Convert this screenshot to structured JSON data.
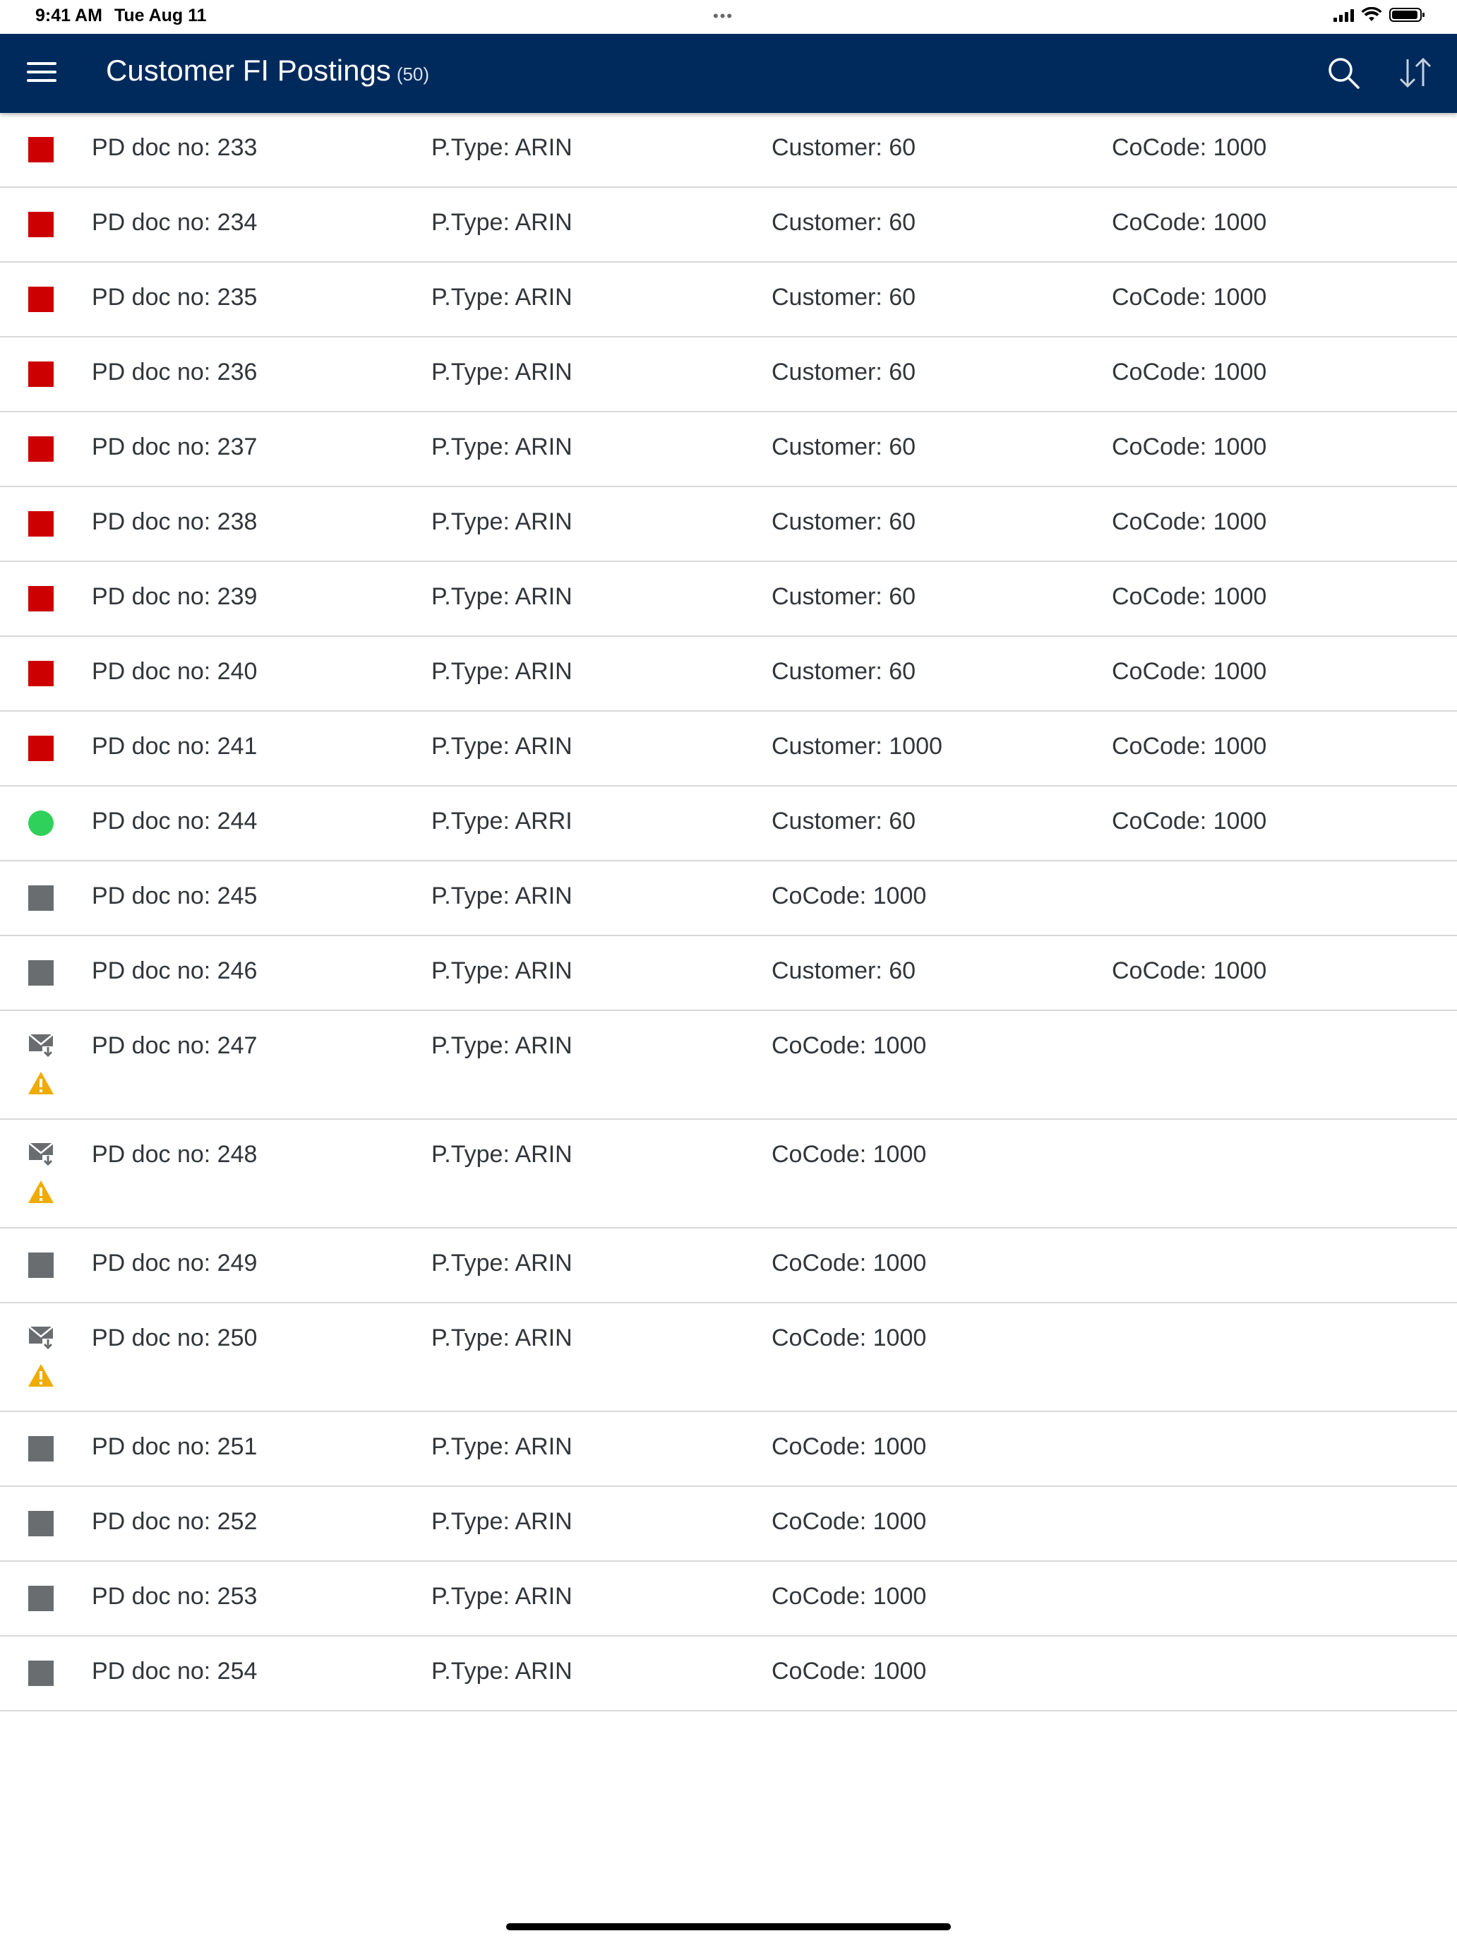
{
  "status_bar": {
    "time": "9:41 AM",
    "date": "Tue Aug 11",
    "dots": "•••"
  },
  "header": {
    "title": "Customer FI Postings",
    "count": "(50)"
  },
  "colors": {
    "nav_bg": "#002a5c",
    "error": "#cc0000",
    "success": "#2fd15a",
    "neutral": "#6a6d70",
    "warning": "#f0ab00"
  },
  "icons": {
    "menu": "menu-icon",
    "search": "search-icon",
    "sort": "sort-icon"
  },
  "rows": [
    {
      "status": "error",
      "doc": "PD doc no: 233",
      "ptype": "P.Type: ARIN",
      "col3": "Customer: 60",
      "col4": "CoCode: 1000"
    },
    {
      "status": "error",
      "doc": "PD doc no: 234",
      "ptype": "P.Type: ARIN",
      "col3": "Customer: 60",
      "col4": "CoCode: 1000"
    },
    {
      "status": "error",
      "doc": "PD doc no: 235",
      "ptype": "P.Type: ARIN",
      "col3": "Customer: 60",
      "col4": "CoCode: 1000"
    },
    {
      "status": "error",
      "doc": "PD doc no: 236",
      "ptype": "P.Type: ARIN",
      "col3": "Customer: 60",
      "col4": "CoCode: 1000"
    },
    {
      "status": "error",
      "doc": "PD doc no: 237",
      "ptype": "P.Type: ARIN",
      "col3": "Customer: 60",
      "col4": "CoCode: 1000"
    },
    {
      "status": "error",
      "doc": "PD doc no: 238",
      "ptype": "P.Type: ARIN",
      "col3": "Customer: 60",
      "col4": "CoCode: 1000"
    },
    {
      "status": "error",
      "doc": "PD doc no: 239",
      "ptype": "P.Type: ARIN",
      "col3": "Customer: 60",
      "col4": "CoCode: 1000"
    },
    {
      "status": "error",
      "doc": "PD doc no: 240",
      "ptype": "P.Type: ARIN",
      "col3": "Customer: 60",
      "col4": "CoCode: 1000"
    },
    {
      "status": "error",
      "doc": "PD doc no: 241",
      "ptype": "P.Type: ARIN",
      "col3": "Customer: 1000",
      "col4": "CoCode: 1000"
    },
    {
      "status": "success",
      "doc": "PD doc no: 244",
      "ptype": "P.Type: ARRI",
      "col3": "Customer: 60",
      "col4": "CoCode: 1000"
    },
    {
      "status": "neutral",
      "doc": "PD doc no: 245",
      "ptype": "P.Type: ARIN",
      "col3": "CoCode: 1000",
      "col4": ""
    },
    {
      "status": "neutral",
      "doc": "PD doc no: 246",
      "ptype": "P.Type: ARIN",
      "col3": "Customer: 60",
      "col4": "CoCode: 1000"
    },
    {
      "status": "mail-warning",
      "doc": "PD doc no: 247",
      "ptype": "P.Type: ARIN",
      "col3": "CoCode: 1000",
      "col4": ""
    },
    {
      "status": "mail-warning",
      "doc": "PD doc no: 248",
      "ptype": "P.Type: ARIN",
      "col3": "CoCode: 1000",
      "col4": ""
    },
    {
      "status": "neutral",
      "doc": "PD doc no: 249",
      "ptype": "P.Type: ARIN",
      "col3": "CoCode: 1000",
      "col4": ""
    },
    {
      "status": "mail-warning",
      "doc": "PD doc no: 250",
      "ptype": "P.Type: ARIN",
      "col3": "CoCode: 1000",
      "col4": ""
    },
    {
      "status": "neutral",
      "doc": "PD doc no: 251",
      "ptype": "P.Type: ARIN",
      "col3": "CoCode: 1000",
      "col4": ""
    },
    {
      "status": "neutral",
      "doc": "PD doc no: 252",
      "ptype": "P.Type: ARIN",
      "col3": "CoCode: 1000",
      "col4": ""
    },
    {
      "status": "neutral",
      "doc": "PD doc no: 253",
      "ptype": "P.Type: ARIN",
      "col3": "CoCode: 1000",
      "col4": ""
    },
    {
      "status": "neutral",
      "doc": "PD doc no: 254",
      "ptype": "P.Type: ARIN",
      "col3": "CoCode: 1000",
      "col4": ""
    }
  ]
}
